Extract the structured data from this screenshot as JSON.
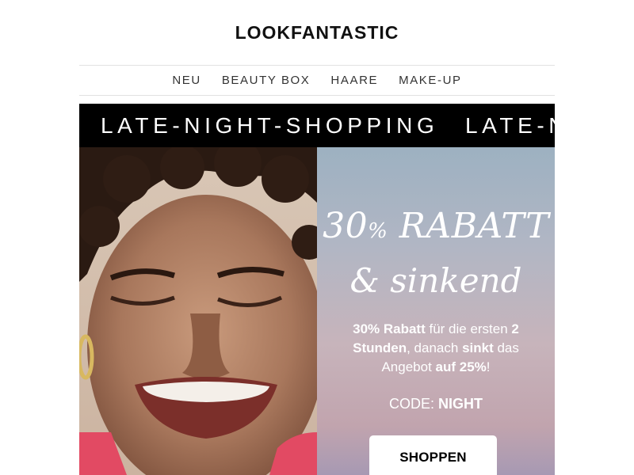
{
  "header": {
    "logo": "LOOKFANTASTIC"
  },
  "nav": {
    "items": [
      "NEU",
      "BEAUTY BOX",
      "HAARE",
      "MAKE-UP"
    ]
  },
  "banner": {
    "text": "LATE-NIGHT-SHOPPING",
    "text_repeat": "LATE-N"
  },
  "promo": {
    "headline_number": "30",
    "headline_pct": "%",
    "headline_word": "RABATT",
    "headline_line2": "& sinkend",
    "desc": {
      "p1_bold": "30% Rabatt",
      "p2": " für die ersten ",
      "p3_bold": "2 Stunden",
      "p4": ", danach ",
      "p5_bold": "sinkt",
      "p6": " das Angebot ",
      "p7_bold": "auf 25%",
      "p8": "!"
    },
    "code_label": "CODE: ",
    "code_value": "NIGHT",
    "button_label": "SHOPPEN"
  },
  "colors": {
    "banner_bg": "#000000",
    "promo_gradient_top": "#9db1c1",
    "promo_gradient_bottom": "#a799b3",
    "button_bg": "#ffffff"
  },
  "images": {
    "hero_photo": "smiling-woman-curly-hair"
  }
}
